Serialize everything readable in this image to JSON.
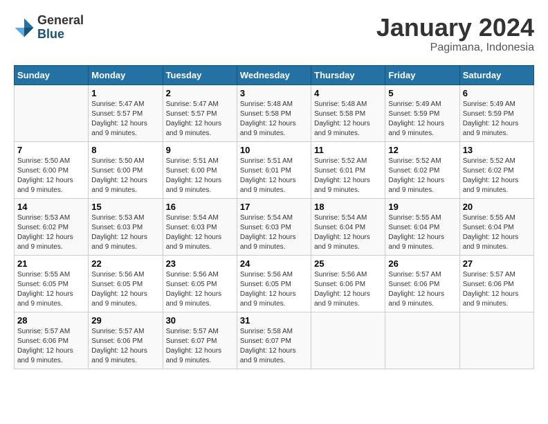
{
  "header": {
    "logo_general": "General",
    "logo_blue": "Blue",
    "month_title": "January 2024",
    "location": "Pagimana, Indonesia"
  },
  "days_of_week": [
    "Sunday",
    "Monday",
    "Tuesday",
    "Wednesday",
    "Thursday",
    "Friday",
    "Saturday"
  ],
  "weeks": [
    [
      {
        "day": "",
        "info": ""
      },
      {
        "day": "1",
        "info": "Sunrise: 5:47 AM\nSunset: 5:57 PM\nDaylight: 12 hours\nand 9 minutes."
      },
      {
        "day": "2",
        "info": "Sunrise: 5:47 AM\nSunset: 5:57 PM\nDaylight: 12 hours\nand 9 minutes."
      },
      {
        "day": "3",
        "info": "Sunrise: 5:48 AM\nSunset: 5:58 PM\nDaylight: 12 hours\nand 9 minutes."
      },
      {
        "day": "4",
        "info": "Sunrise: 5:48 AM\nSunset: 5:58 PM\nDaylight: 12 hours\nand 9 minutes."
      },
      {
        "day": "5",
        "info": "Sunrise: 5:49 AM\nSunset: 5:59 PM\nDaylight: 12 hours\nand 9 minutes."
      },
      {
        "day": "6",
        "info": "Sunrise: 5:49 AM\nSunset: 5:59 PM\nDaylight: 12 hours\nand 9 minutes."
      }
    ],
    [
      {
        "day": "7",
        "info": ""
      },
      {
        "day": "8",
        "info": "Sunrise: 5:50 AM\nSunset: 6:00 PM\nDaylight: 12 hours\nand 9 minutes."
      },
      {
        "day": "9",
        "info": "Sunrise: 5:51 AM\nSunset: 6:00 PM\nDaylight: 12 hours\nand 9 minutes."
      },
      {
        "day": "10",
        "info": "Sunrise: 5:51 AM\nSunset: 6:01 PM\nDaylight: 12 hours\nand 9 minutes."
      },
      {
        "day": "11",
        "info": "Sunrise: 5:52 AM\nSunset: 6:01 PM\nDaylight: 12 hours\nand 9 minutes."
      },
      {
        "day": "12",
        "info": "Sunrise: 5:52 AM\nSunset: 6:02 PM\nDaylight: 12 hours\nand 9 minutes."
      },
      {
        "day": "13",
        "info": "Sunrise: 5:52 AM\nSunset: 6:02 PM\nDaylight: 12 hours\nand 9 minutes."
      }
    ],
    [
      {
        "day": "14",
        "info": ""
      },
      {
        "day": "15",
        "info": "Sunrise: 5:53 AM\nSunset: 6:03 PM\nDaylight: 12 hours\nand 9 minutes."
      },
      {
        "day": "16",
        "info": "Sunrise: 5:54 AM\nSunset: 6:03 PM\nDaylight: 12 hours\nand 9 minutes."
      },
      {
        "day": "17",
        "info": "Sunrise: 5:54 AM\nSunset: 6:03 PM\nDaylight: 12 hours\nand 9 minutes."
      },
      {
        "day": "18",
        "info": "Sunrise: 5:54 AM\nSunset: 6:04 PM\nDaylight: 12 hours\nand 9 minutes."
      },
      {
        "day": "19",
        "info": "Sunrise: 5:55 AM\nSunset: 6:04 PM\nDaylight: 12 hours\nand 9 minutes."
      },
      {
        "day": "20",
        "info": "Sunrise: 5:55 AM\nSunset: 6:04 PM\nDaylight: 12 hours\nand 9 minutes."
      }
    ],
    [
      {
        "day": "21",
        "info": ""
      },
      {
        "day": "22",
        "info": "Sunrise: 5:56 AM\nSunset: 6:05 PM\nDaylight: 12 hours\nand 9 minutes."
      },
      {
        "day": "23",
        "info": "Sunrise: 5:56 AM\nSunset: 6:05 PM\nDaylight: 12 hours\nand 9 minutes."
      },
      {
        "day": "24",
        "info": "Sunrise: 5:56 AM\nSunset: 6:05 PM\nDaylight: 12 hours\nand 9 minutes."
      },
      {
        "day": "25",
        "info": "Sunrise: 5:56 AM\nSunset: 6:06 PM\nDaylight: 12 hours\nand 9 minutes."
      },
      {
        "day": "26",
        "info": "Sunrise: 5:57 AM\nSunset: 6:06 PM\nDaylight: 12 hours\nand 9 minutes."
      },
      {
        "day": "27",
        "info": "Sunrise: 5:57 AM\nSunset: 6:06 PM\nDaylight: 12 hours\nand 9 minutes."
      }
    ],
    [
      {
        "day": "28",
        "info": "Sunrise: 5:57 AM\nSunset: 6:06 PM\nDaylight: 12 hours\nand 9 minutes."
      },
      {
        "day": "29",
        "info": "Sunrise: 5:57 AM\nSunset: 6:06 PM\nDaylight: 12 hours\nand 9 minutes."
      },
      {
        "day": "30",
        "info": "Sunrise: 5:57 AM\nSunset: 6:07 PM\nDaylight: 12 hours\nand 9 minutes."
      },
      {
        "day": "31",
        "info": "Sunrise: 5:58 AM\nSunset: 6:07 PM\nDaylight: 12 hours\nand 9 minutes."
      },
      {
        "day": "",
        "info": ""
      },
      {
        "day": "",
        "info": ""
      },
      {
        "day": "",
        "info": ""
      }
    ]
  ],
  "week1_sunday_info": "Sunrise: 5:50 AM\nSunset: 6:00 PM\nDaylight: 12 hours\nand 9 minutes.",
  "week2_sunday_info": "Sunrise: 5:53 AM\nSunset: 6:02 PM\nDaylight: 12 hours\nand 9 minutes.",
  "week3_sunday_info": "Sunrise: 5:55 AM\nSunset: 6:05 PM\nDaylight: 12 hours\nand 9 minutes."
}
